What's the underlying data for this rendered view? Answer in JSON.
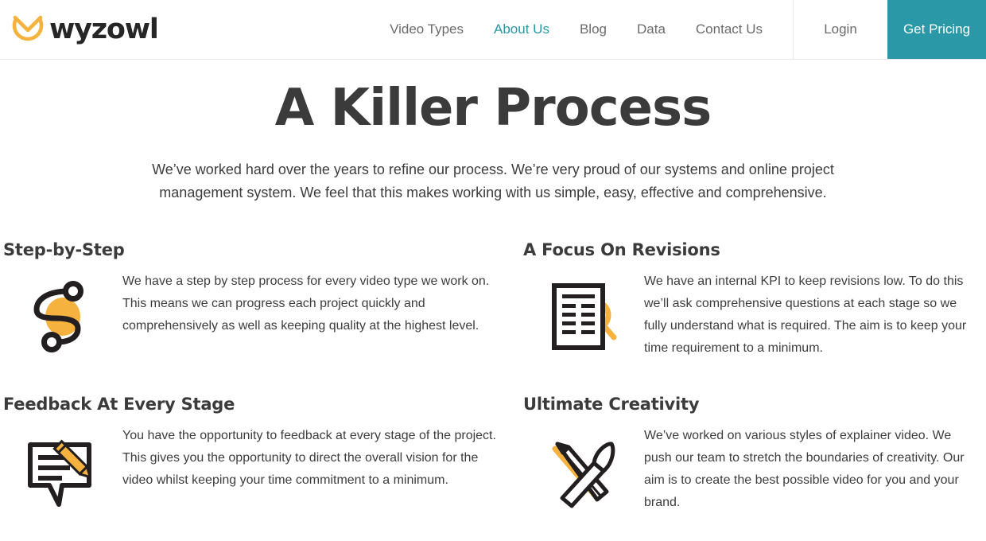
{
  "header": {
    "logo": {
      "mark_icon": "owl-circle-mark",
      "wordmark": "wyzowl",
      "mark_color": "#F5B23E"
    },
    "nav": [
      {
        "label": "Video Types",
        "active": false
      },
      {
        "label": "About Us",
        "active": true
      },
      {
        "label": "Blog",
        "active": false
      },
      {
        "label": "Data",
        "active": false
      },
      {
        "label": "Contact Us",
        "active": false
      }
    ],
    "login_label": "Login",
    "pricing_label": "Get Pricing",
    "accent_color": "#2A98A6"
  },
  "hero": {
    "title": "A Killer Process",
    "subtitle": "We’ve worked hard over the years to refine our process. We’re very proud of our systems and online project management system. We feel that this makes working with us simple, easy, effective and comprehensive."
  },
  "features": [
    {
      "title": "Step-by-Step",
      "icon": "step-path-icon",
      "text": "We have a step by step process for every video type we work on. This means we can progress each project quickly and comprehensively as well as keeping quality at the highest level."
    },
    {
      "title": "A Focus On Revisions",
      "icon": "document-magnifier-icon",
      "text": "We have an internal KPI to keep revisions low. To do this we’ll ask comprehensive questions at each stage so we fully understand what is required. The aim is to keep your time requirement to a minimum."
    },
    {
      "title": "Feedback At Every Stage",
      "icon": "speech-bubble-pencil-icon",
      "text": "You have the opportunity to feedback at every stage of the project. This gives you the opportunity to direct the overall vision for the video whilst keeping your time commitment to a minimum."
    },
    {
      "title": "Ultimate Creativity",
      "icon": "pencil-brush-icon",
      "text": "We’ve worked on various styles of explainer video. We push our team to stretch the boundaries of creativity. Our aim is to create the best possible video for you and your brand."
    }
  ],
  "colors": {
    "orange": "#F5B23E",
    "dark": "#231F20",
    "teal": "#2A98A6",
    "text": "#3D3D3D"
  }
}
